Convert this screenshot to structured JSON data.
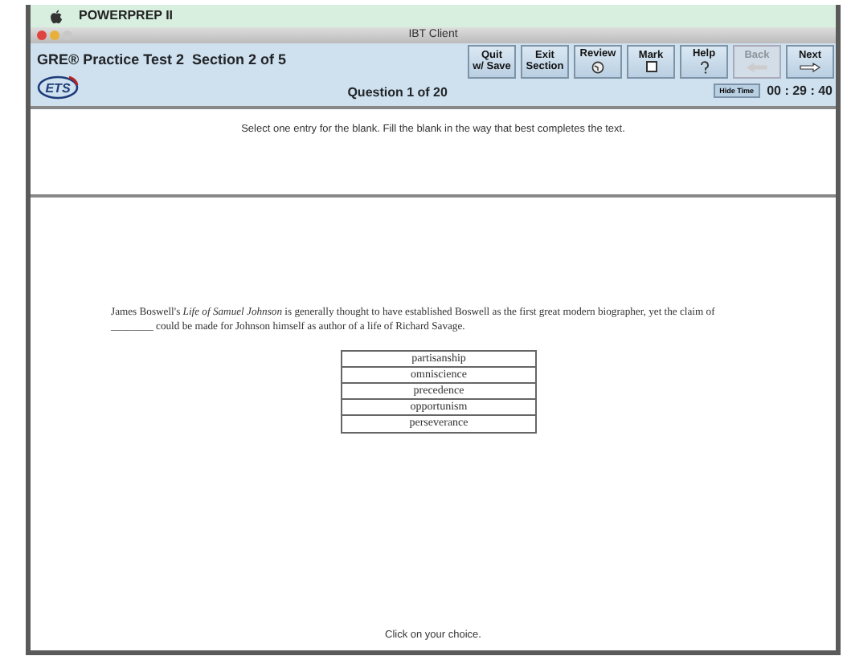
{
  "menu_bar": {
    "app_name": "POWERPREP II"
  },
  "window": {
    "title": "IBT Client"
  },
  "header": {
    "test_title": "GRE® Practice Test 2  Section 2 of 5",
    "question_counter": "Question 1 of 20",
    "hide_time_button": "Hide Time",
    "timer": "00 : 29 : 40",
    "logo": "ETS"
  },
  "toolbar_buttons": [
    {
      "label": "Quit\nw/ Save",
      "kind": "text",
      "disabled": false
    },
    {
      "label": "Exit\nSection",
      "kind": "text",
      "disabled": false
    },
    {
      "label": "Review",
      "kind": "review",
      "disabled": false
    },
    {
      "label": "Mark",
      "kind": "mark",
      "disabled": false
    },
    {
      "label": "Help",
      "kind": "help",
      "disabled": false
    },
    {
      "label": "Back",
      "kind": "back",
      "disabled": true
    },
    {
      "label": "Next",
      "kind": "next",
      "disabled": false
    }
  ],
  "instructions": "Select one entry for the blank. Fill the blank in the way that best completes the text.",
  "passage": "James Boswell's *Life of Samuel Johnson* is generally thought to have established Boswell as the first great modern biographer, yet the claim of ________ could be made for Johnson himself as author of a life of Richard Savage.",
  "choices": [
    {
      "label": "partisanship",
      "selected": false
    },
    {
      "label": "omniscience",
      "selected": false
    },
    {
      "label": "precedence",
      "selected": false
    },
    {
      "label": "opportunism",
      "selected": false
    },
    {
      "label": "perseverance",
      "selected": false
    }
  ],
  "footer_hint": "Click on your choice."
}
